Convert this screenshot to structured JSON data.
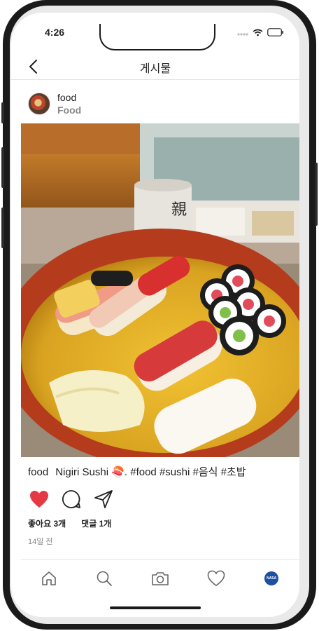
{
  "status_bar": {
    "time": "4:26"
  },
  "header": {
    "title": "게시물"
  },
  "post": {
    "username": "food",
    "subtitle": "Food",
    "caption_user": "food",
    "caption_text": "Nigiri Sushi 🍣. #food #sushi #음식 #초밥",
    "likes": "좋아요 3개",
    "comments": "댓글 1개",
    "time_ago": "14일 전",
    "liked": true
  },
  "tabbar": {
    "items": [
      "home-icon",
      "search-icon",
      "camera-icon",
      "heart-icon",
      "profile-avatar"
    ],
    "profile_label": "NASA"
  },
  "colors": {
    "like": "#e63946",
    "text": "#222222",
    "muted": "#888888"
  }
}
